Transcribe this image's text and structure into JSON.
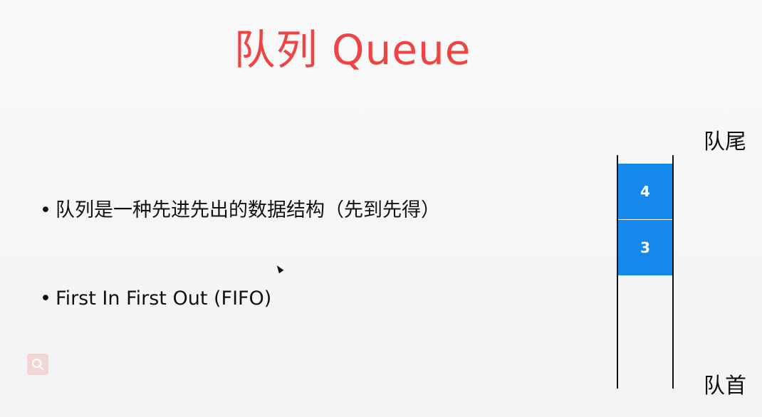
{
  "title": "队列 Queue",
  "bullets": [
    {
      "marker": "•",
      "text": "队列是一种先进先出的数据结构（先到先得）"
    },
    {
      "marker": "•",
      "text": "First In First Out (FIFO)"
    }
  ],
  "queue": {
    "tail_label": "队尾",
    "head_label": "队首",
    "items": [
      "4",
      "3"
    ]
  },
  "colors": {
    "title": "#ee4444",
    "queue_item": "#1588ec",
    "zoom_button": "#f2d6d6"
  },
  "icons": {
    "cursor": "arrow-cursor-icon",
    "zoom": "magnifier-icon"
  }
}
